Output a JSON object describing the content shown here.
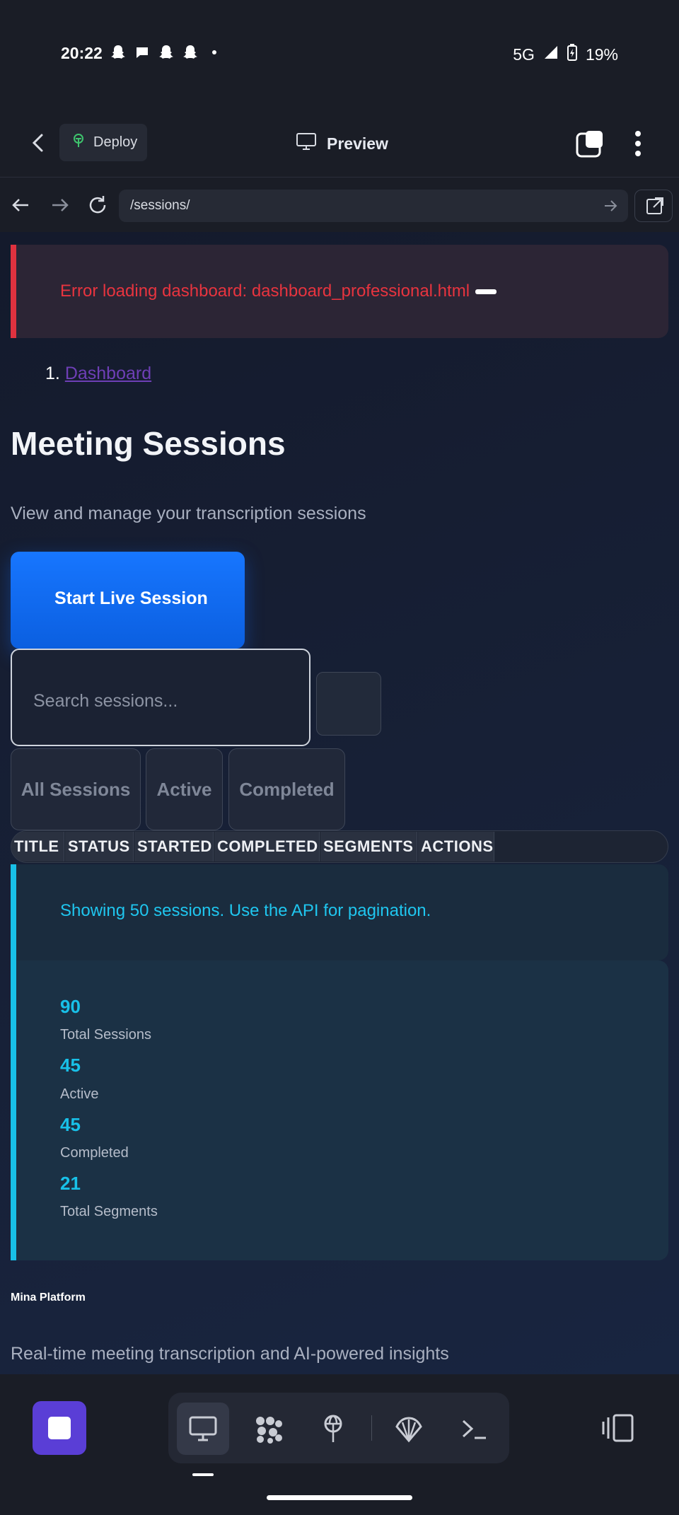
{
  "status_bar": {
    "time": "20:22",
    "network": "5G",
    "battery": "19%"
  },
  "topbar": {
    "deploy_label": "Deploy",
    "preview_label": "Preview"
  },
  "browser": {
    "url": "/sessions/"
  },
  "page": {
    "error_message": "Error loading dashboard: dashboard_professional.html",
    "breadcrumb_index": "1.",
    "breadcrumb": "Dashboard",
    "title": "Meeting Sessions",
    "subtitle": "View and manage your transcription sessions",
    "start_button": "Start Live Session",
    "search_placeholder": "Search sessions...",
    "filters": [
      "All Sessions",
      "Active",
      "Completed"
    ],
    "table_headers": [
      "TITLE",
      "STATUS",
      "STARTED",
      "COMPLETED",
      "SEGMENTS",
      "ACTIONS"
    ],
    "info_message": "Showing 50 sessions. Use the API for pagination.",
    "stats": [
      {
        "value": "90",
        "label": "Total Sessions"
      },
      {
        "value": "45",
        "label": "Active"
      },
      {
        "value": "45",
        "label": "Completed"
      },
      {
        "value": "21",
        "label": "Total Segments"
      }
    ],
    "footer_brand": "Mina Platform",
    "footer_tagline": "Real-time meeting transcription and AI-powered insights"
  },
  "colors": {
    "error": "#e8343f",
    "primary": "#1776ff",
    "info": "#18c0e8",
    "link": "#6e3fb6",
    "stop": "#5a3ed6"
  },
  "icons": {
    "status_left": [
      "snapchat-icon",
      "chat-bubble-icon",
      "snapchat-icon",
      "snapchat-icon",
      "dot-icon"
    ],
    "bottom_tools": [
      "monitor-icon",
      "grid-apps-icon",
      "deploy-icon",
      "shell-icon",
      "terminal-icon"
    ]
  }
}
